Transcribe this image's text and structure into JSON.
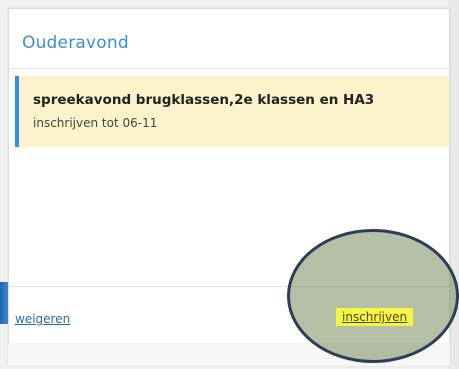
{
  "card": {
    "title": "Ouderavond"
  },
  "event": {
    "title": "spreekavond brugklassen,2e klassen en HA3",
    "deadline": "inschrijven tot 06-11"
  },
  "actions": {
    "decline_label": "weigeren",
    "accept_label": "inschrijven"
  },
  "colors": {
    "accent_blue": "#3a8fd1",
    "item_bg": "#fcf3cc",
    "item_border": "#2e93e6",
    "highlight_yellow": "#f5f542",
    "annotation_ellipse": "#2c3d57"
  }
}
